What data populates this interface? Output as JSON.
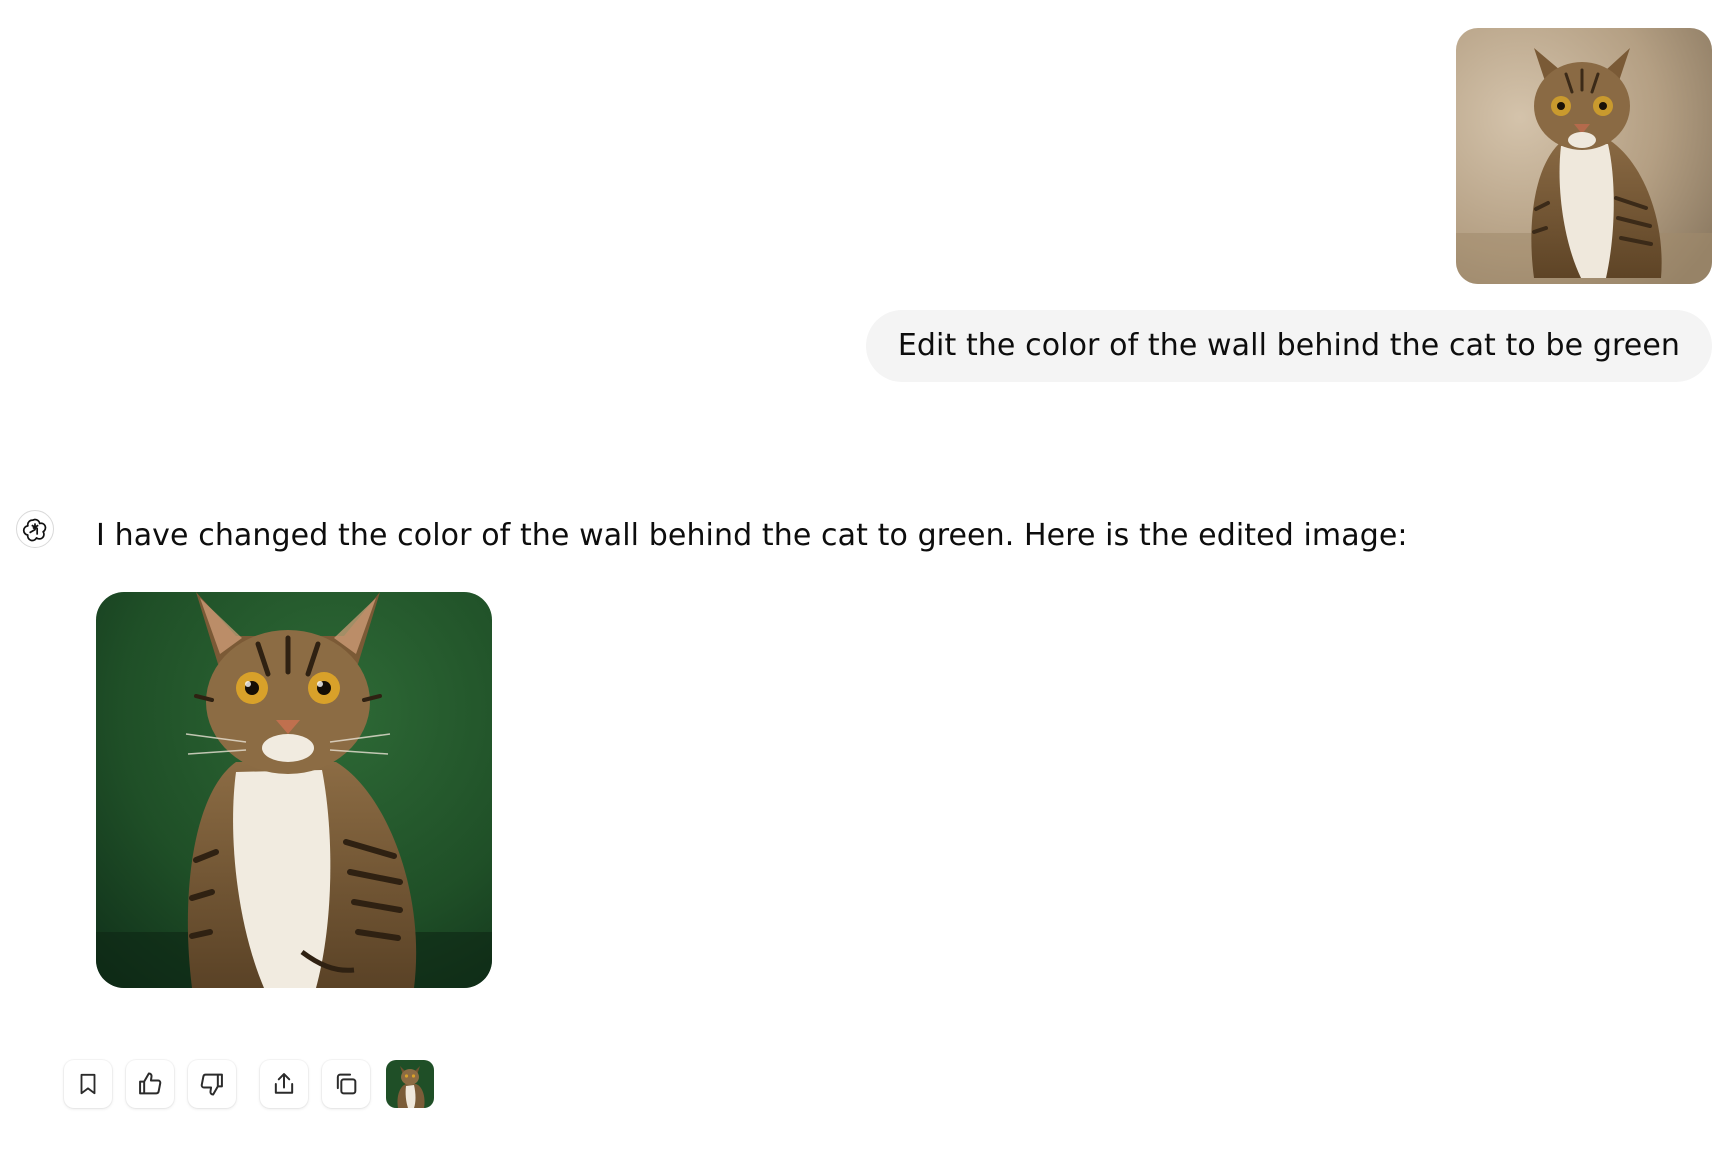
{
  "user_message": {
    "image": {
      "description_icon": "cat-photo-beige-wall",
      "wall_color": "#b8a58c"
    },
    "text": "Edit the color of the wall behind the cat to be green"
  },
  "assistant_message": {
    "avatar_icon": "assistant-logo-icon",
    "text": "I have changed the color of the wall behind the cat to green. Here is the edited image:",
    "image": {
      "description_icon": "cat-photo-green-wall",
      "wall_color": "#1f4f27"
    }
  },
  "actions": [
    {
      "name": "bookmark",
      "icon": "bookmark-icon"
    },
    {
      "name": "thumbs-up",
      "icon": "thumbs-up-icon"
    },
    {
      "name": "thumbs-down",
      "icon": "thumbs-down-icon"
    },
    {
      "name": "share",
      "icon": "share-icon"
    },
    {
      "name": "copy",
      "icon": "copy-icon"
    },
    {
      "name": "image-thumbnail",
      "icon": "image-thumbnail-icon"
    }
  ]
}
